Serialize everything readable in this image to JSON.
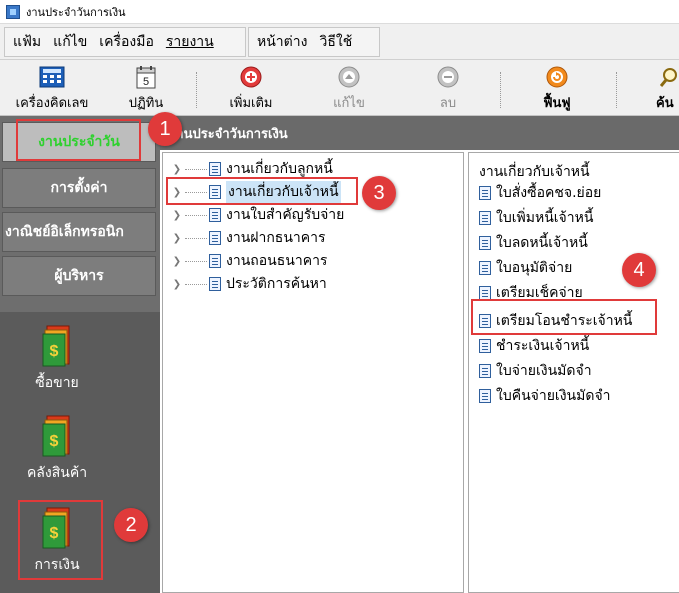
{
  "window": {
    "title": "งานประจำวันการเงิน"
  },
  "menu": {
    "group1": [
      "แฟ้ม",
      "แก้ไข",
      "เครื่องมือ",
      "รายงาน"
    ],
    "group2": [
      "หน้าต่าง",
      "วิธีใช้"
    ]
  },
  "toolbar": {
    "calculator": "เครื่องคิดเลข",
    "calendar": "ปฏิทิน",
    "calendar_day": "5",
    "add": "เพิ่มเติม",
    "edit": "แก้ไข",
    "delete": "ลบ",
    "refresh": "ฟื้นฟู",
    "search_partial": "ค้น"
  },
  "sidebar": {
    "tabs": [
      "งานประจำวัน",
      "การตั้งค่า",
      "งาณิชย์อิเล็กทรอนิก",
      "ผู้บริหาร"
    ],
    "icons": [
      "ซื้อขาย",
      "คลังสินค้า",
      "การเงิน"
    ]
  },
  "header": {
    "title": "งานประจำวันการเงิน"
  },
  "tree": {
    "items": [
      "งานเกี่ยวกับลูกหนี้",
      "งานเกี่ยวกับเจ้าหนี้",
      "งานใบสำคัญรับจ่าย",
      "งานฝากธนาคาร",
      "งานถอนธนาคาร",
      "ประวัติการค้นหา"
    ]
  },
  "list": {
    "heading": "งานเกี่ยวกับเจ้าหนี้",
    "items": [
      "ใบสั่งซื้อคชจ.ย่อย",
      "ใบเพิ่มหนี้เจ้าหนี้",
      "ใบลดหนี้เจ้าหนี้",
      "ใบอนุมัติจ่าย",
      "เตรียมเช็คจ่าย",
      "เตรียมโอนชำระเจ้าหนี้",
      "ชำระเงินเจ้าหนี้",
      "ใบจ่ายเงินมัดจำ",
      "ใบคืนจ่ายเงินมัดจำ"
    ]
  },
  "annotations": {
    "steps": [
      "1",
      "2",
      "3",
      "4"
    ],
    "color": "#e03a3a"
  },
  "colors": {
    "active_tab_text": "#2fd12f",
    "sidebar_bg": "#6e6e6e",
    "header_bg": "#6a6a6a",
    "selection_bg": "#cce4f7"
  }
}
